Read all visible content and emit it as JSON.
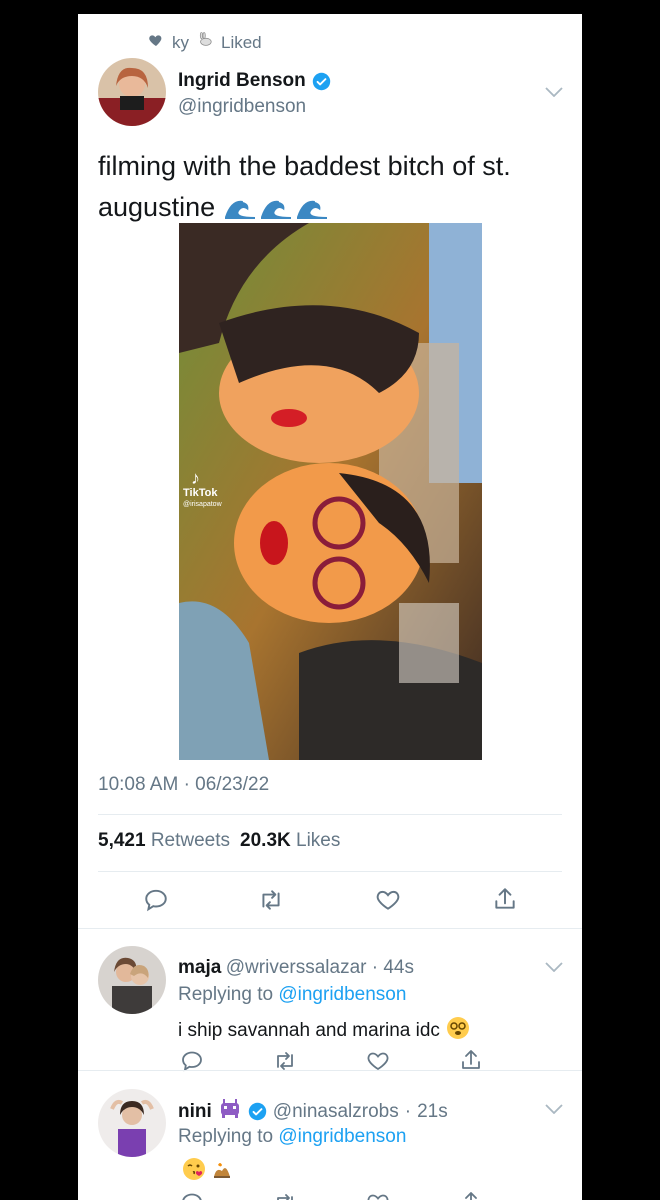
{
  "social_context": {
    "user": "ky",
    "action": "Liked"
  },
  "tweet": {
    "display_name": "Ingrid Benson",
    "handle": "@ingridbenson",
    "text_line1": "filming with the baddest bitch of st.",
    "text_line2": "augustine",
    "media_watermark_brand": "TikTok",
    "media_watermark_handle": "@irisapatow",
    "time": "10:08 AM",
    "date": "06/23/22",
    "retweets_count": "5,421",
    "retweets_label": "Retweets",
    "likes_count": "20.3K",
    "likes_label": "Likes"
  },
  "replies": [
    {
      "display_name": "maja",
      "handle": "@wriverssalazar",
      "age": "44s",
      "replying_prefix": "Replying to",
      "replying_to": "@ingridbenson",
      "text": "i ship savannah and marina idc"
    },
    {
      "display_name": "nini",
      "handle": "@ninasalzrobs",
      "age": "21s",
      "replying_prefix": "Replying to",
      "replying_to": "@ingridbenson",
      "text": ""
    }
  ],
  "icons": {
    "heart": "heart-icon",
    "reply": "reply-icon",
    "retweet": "retweet-icon",
    "share": "share-icon",
    "verified": "verified-badge-icon",
    "menu": "chevron-down-icon"
  },
  "colors": {
    "accent": "#1da1f2",
    "muted": "#657786",
    "text": "#14171a",
    "divider": "#e6ecf0"
  }
}
